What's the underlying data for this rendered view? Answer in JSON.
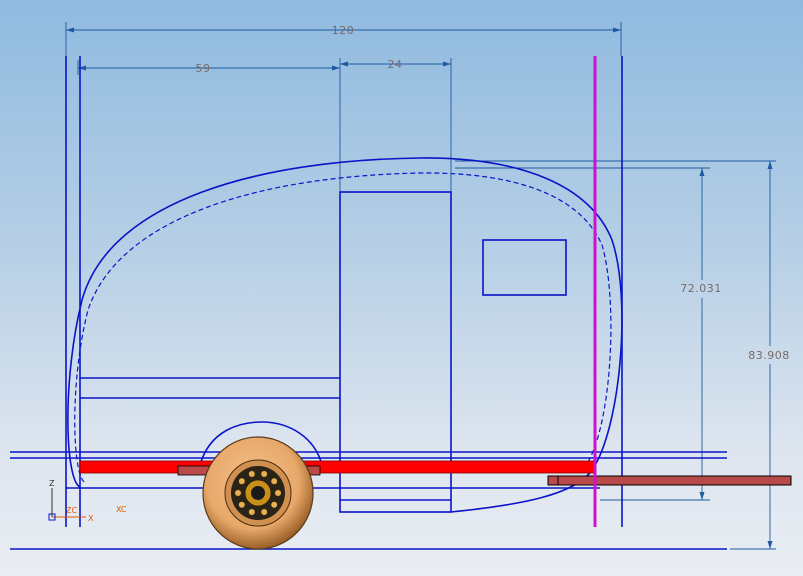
{
  "drawing": {
    "dimensions": {
      "overall_length": "120",
      "front_offset": "59",
      "door_width": "24",
      "body_height": "72.031",
      "overall_height": "83.908"
    },
    "triad": {
      "z_label": "Z",
      "x_label": "X",
      "zc_label": "ZC",
      "xc_label": "XC"
    },
    "colors": {
      "geometry": "#0a14c8",
      "dimension": "#1e5aa0",
      "dimension_text": "#7a6a6a",
      "frame_rail": "#ff0000",
      "tongue": "#b84a4a",
      "datum_plane": "#d010d0",
      "tire": "#e8a86a",
      "wheel_hub": "#1a1a1a",
      "triad_x": "#e05a00",
      "triad_z": "#303030"
    }
  }
}
